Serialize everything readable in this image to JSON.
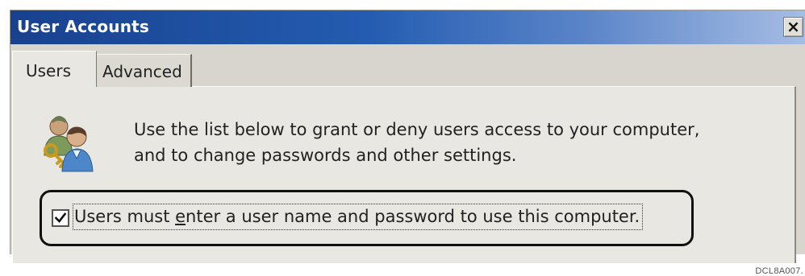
{
  "window": {
    "title": "User Accounts",
    "close_glyph": "×"
  },
  "tabs": [
    {
      "label": "Users",
      "selected": true
    },
    {
      "label": "Advanced",
      "selected": false
    }
  ],
  "users_panel": {
    "icon": "users-icon",
    "description_line1": "Use the list below to grant or deny users access to your computer,",
    "description_line2": "and to change passwords and other settings.",
    "require_password": {
      "checked": true,
      "label_pre": "Users must ",
      "label_mnemonic": "e",
      "label_post": "nter a user name and password to use this computer."
    }
  },
  "figure_caption": "DCL8A007.",
  "colors": {
    "titlebar_dark": "#18418e",
    "titlebar_light": "#a6bde3",
    "dialog_face": "#d8d5cf",
    "panel_face": "#e9e7e2",
    "text": "#222222"
  }
}
